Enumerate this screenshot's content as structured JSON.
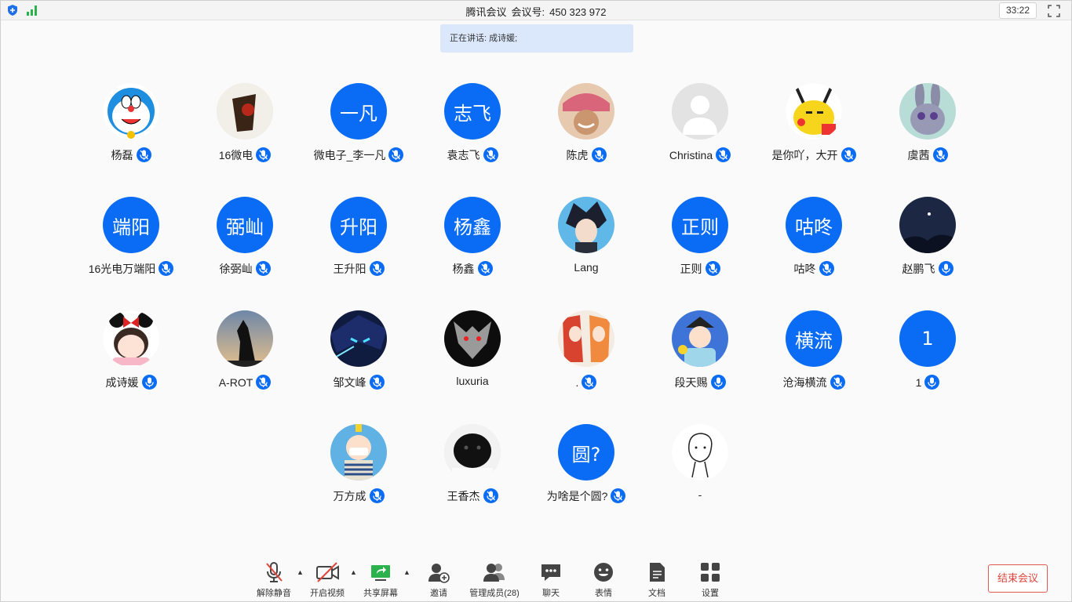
{
  "titlebar": {
    "app_name": "腾讯会议",
    "meeting_label": "会议号:",
    "meeting_id": "450 323 972",
    "timer": "33:22"
  },
  "speaking": "正在讲话: 成诗媛;",
  "participants": [
    {
      "name": "杨磊",
      "avatar": "doraemon",
      "kind": "photo"
    },
    {
      "name": "16微电",
      "avatar": "dark-figure",
      "kind": "photo"
    },
    {
      "name": "微电子_李一凡",
      "avatar_text": "一凡",
      "kind": "text"
    },
    {
      "name": "袁志飞",
      "avatar_text": "志飞",
      "kind": "text"
    },
    {
      "name": "陈虎",
      "avatar": "chopper",
      "kind": "photo"
    },
    {
      "name": "Christina",
      "avatar": "default-person",
      "kind": "photo"
    },
    {
      "name": "是你吖，大开",
      "avatar": "pikachu",
      "kind": "photo"
    },
    {
      "name": "虞茜",
      "avatar": "bunny",
      "kind": "photo"
    },
    {
      "name": "16光电万端阳",
      "avatar_text": "端阳",
      "kind": "text"
    },
    {
      "name": "徐弼屾",
      "avatar_text": "弼屾",
      "kind": "text"
    },
    {
      "name": "王升阳",
      "avatar_text": "升阳",
      "kind": "text"
    },
    {
      "name": "杨鑫",
      "avatar_text": "杨鑫",
      "kind": "text"
    },
    {
      "name": "Lang",
      "avatar": "anime-boy",
      "kind": "photo",
      "no_mic": true
    },
    {
      "name": "正则",
      "avatar_text": "正则",
      "kind": "text"
    },
    {
      "name": "咕咚",
      "avatar_text": "咕咚",
      "kind": "text"
    },
    {
      "name": "赵鹏飞",
      "avatar": "night-sky",
      "kind": "photo",
      "mic_active": true
    },
    {
      "name": "成诗媛",
      "avatar": "bow-girl",
      "kind": "photo",
      "mic_active": true
    },
    {
      "name": "A-ROT",
      "avatar": "sunset-dog",
      "kind": "photo"
    },
    {
      "name": "邹文峰",
      "avatar": "blue-anime",
      "kind": "photo"
    },
    {
      "name": "luxuria",
      "avatar": "wolf-medallion",
      "kind": "photo",
      "no_mic": true
    },
    {
      "name": ".",
      "avatar": "two-girls",
      "kind": "photo"
    },
    {
      "name": "段天赐",
      "avatar": "cartoon-boy",
      "kind": "photo",
      "mic_active": true
    },
    {
      "name": "沧海横流",
      "avatar_text": "横流",
      "kind": "text"
    },
    {
      "name": "1",
      "avatar_text": "1",
      "kind": "text",
      "mic_active": true
    },
    {
      "name": "万方成",
      "avatar": "kid-glasses",
      "kind": "photo"
    },
    {
      "name": "王香杰",
      "avatar": "puppy",
      "kind": "photo"
    },
    {
      "name": "为啥是个圆?",
      "avatar_text": "圆?",
      "kind": "text"
    },
    {
      "name": "-",
      "avatar": "sketch",
      "kind": "photo",
      "no_mic": true
    }
  ],
  "toolbar": {
    "unmute": "解除静音",
    "video": "开启视频",
    "share": "共享屏幕",
    "invite": "邀请",
    "members": "管理成员(28)",
    "chat": "聊天",
    "emoji": "表情",
    "docs": "文档",
    "settings": "设置",
    "end": "结束会议"
  },
  "colors": {
    "accent": "#0a6cf5",
    "end": "#e0443a",
    "speaking_bg": "#dbe8fb"
  }
}
